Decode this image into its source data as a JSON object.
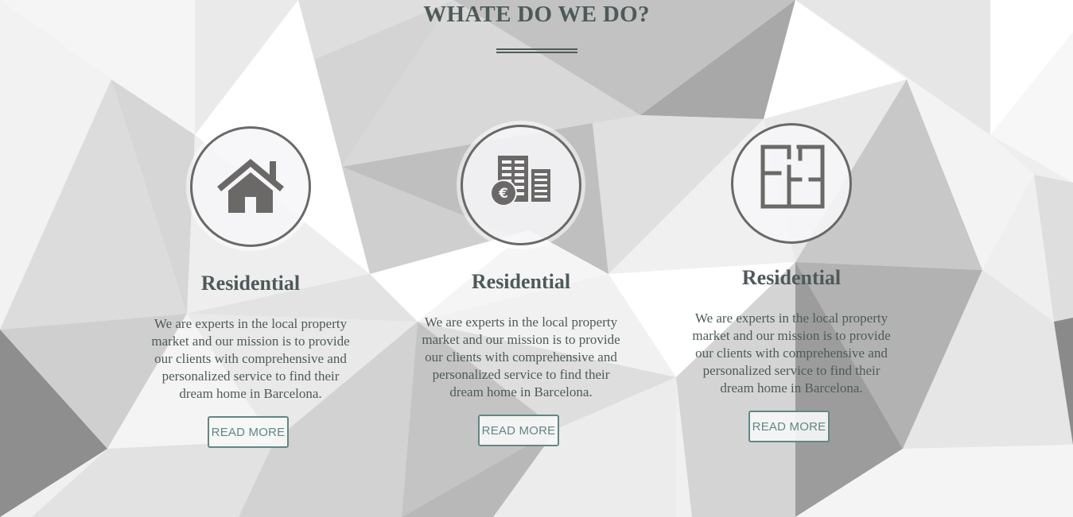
{
  "section": {
    "title": "WHATE DO WE DO?"
  },
  "cards": [
    {
      "icon": "house-icon",
      "title": "Residential",
      "text": "We are experts in the local property market and our mission is to provide our clients with comprehensive and personalized service to find their dream home in Barcelona.",
      "button_label": "READ MORE"
    },
    {
      "icon": "buildings-euro-icon",
      "title": "Residential",
      "text": "We are experts in the local property market and our mission is to provide our clients with comprehensive and personalized service to find their dream home in Barcelona.",
      "button_label": "READ MORE"
    },
    {
      "icon": "floor-plan-icon",
      "title": "Residential",
      "text": "We are experts in the local property market and our mission is to provide our clients with comprehensive and personalized service to find their dream home in Barcelona.",
      "button_label": "READ MORE"
    }
  ],
  "colors": {
    "heading": "#4e5a5a",
    "accent": "#5f8884",
    "icon": "#6b6968"
  }
}
